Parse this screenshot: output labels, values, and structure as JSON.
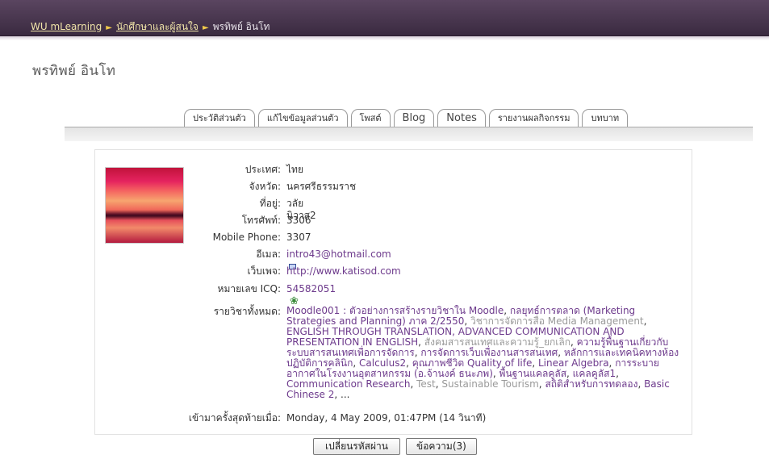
{
  "breadcrumb": {
    "home": "WU mLearning",
    "section": "นักศึกษาและผู้สนใจ",
    "current": "พรทิพย์ อินโท"
  },
  "page_title": "พรทิพย์ อินโท",
  "tabs": [
    {
      "label": "ประวัติส่วนตัว",
      "active": true
    },
    {
      "label": "แก้ไขข้อมูลส่วนตัว",
      "active": false
    },
    {
      "label": "โพสต์",
      "active": false
    },
    {
      "label": "Blog",
      "active": false
    },
    {
      "label": "Notes",
      "active": false
    },
    {
      "label": "รายงานผลกิจกรรม",
      "active": false
    },
    {
      "label": "บทบาท",
      "active": false
    }
  ],
  "profile": {
    "country_label": "ประเทศ:",
    "country": "ไทย",
    "province_label": "จังหวัด:",
    "province": "นครศรีธรรมราช",
    "address_label": "ที่อยู่:",
    "address": "วลัยนิวาส2",
    "phone_label": "โทรศัพท์:",
    "phone": "3306",
    "mobile_label": "Mobile Phone:",
    "mobile": "3307",
    "email_label": "อีเมล:",
    "email": "intro43@hotmail.com",
    "web_label": "เว็บเพจ:",
    "web": "http://www.katisod.com",
    "icq_label": "หมายเลข ICQ:",
    "icq": "54582051",
    "courses_label": "รายวิชาทั้งหมด:",
    "courses": [
      {
        "name": "Moodle001 : ตัวอย่างการสร้างรายวิชาใน Moodle",
        "dim": false
      },
      {
        "name": "กลยุทธ์การตลาด (Marketing Strategies and Planning) ภาค 2/2550",
        "dim": false
      },
      {
        "name": "วิชาการจัดการสื่อ Media Management",
        "dim": true
      },
      {
        "name": "ENGLISH THROUGH TRANSLATION, ADVANCED COMMUNICATION AND PRESENTATION IN ENGLISH",
        "dim": false
      },
      {
        "name": "สังคมสารสนเทศและความรู้_ยกเลิก",
        "dim": true
      },
      {
        "name": "ความรู้พื้นฐานเกี่ยวกับระบบสารสนเทศเพื่อการจัดการ",
        "dim": false
      },
      {
        "name": "การจัดการเว็บเพื่องานสารสนเทศ",
        "dim": false
      },
      {
        "name": "หลักการและเทคนิคทางห้องปฏิบัติการคลินิก",
        "dim": false
      },
      {
        "name": "Calculus2",
        "dim": false
      },
      {
        "name": "คุณภาพชีวิต Quality of life",
        "dim": false
      },
      {
        "name": "Linear Algebra",
        "dim": false
      },
      {
        "name": "การระบายอากาศในโรงงานอุตสาหกรรม (อ.จ้านงค์ ธนะภพ)",
        "dim": false
      },
      {
        "name": "พื้นฐานแคลคูลัส",
        "dim": false
      },
      {
        "name": "แคลคูลัส1",
        "dim": false
      },
      {
        "name": "Communication Research",
        "dim": false
      },
      {
        "name": "Test",
        "dim": true
      },
      {
        "name": "Sustainable Tourism",
        "dim": true
      },
      {
        "name": "สถิติสำหรับการทดลอง",
        "dim": false
      },
      {
        "name": "Basic Chinese 2",
        "dim": false
      }
    ],
    "courses_more": "...",
    "last_access_label": "เข้ามาครั้งสุดท้ายเมื่อ:",
    "last_access": "Monday, 4 May 2009, 01:47PM  (14 วินาที)"
  },
  "buttons": {
    "change_password": "เปลี่ยนรหัสผ่าน",
    "messages": "ข้อความ(3)"
  }
}
